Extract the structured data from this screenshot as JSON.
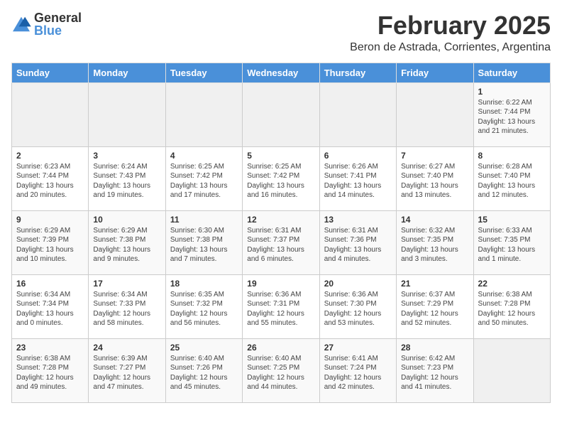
{
  "logo": {
    "general": "General",
    "blue": "Blue"
  },
  "header": {
    "title": "February 2025",
    "subtitle": "Beron de Astrada, Corrientes, Argentina"
  },
  "weekdays": [
    "Sunday",
    "Monday",
    "Tuesday",
    "Wednesday",
    "Thursday",
    "Friday",
    "Saturday"
  ],
  "weeks": [
    [
      {
        "day": "",
        "detail": ""
      },
      {
        "day": "",
        "detail": ""
      },
      {
        "day": "",
        "detail": ""
      },
      {
        "day": "",
        "detail": ""
      },
      {
        "day": "",
        "detail": ""
      },
      {
        "day": "",
        "detail": ""
      },
      {
        "day": "1",
        "detail": "Sunrise: 6:22 AM\nSunset: 7:44 PM\nDaylight: 13 hours\nand 21 minutes."
      }
    ],
    [
      {
        "day": "2",
        "detail": "Sunrise: 6:23 AM\nSunset: 7:44 PM\nDaylight: 13 hours\nand 20 minutes."
      },
      {
        "day": "3",
        "detail": "Sunrise: 6:24 AM\nSunset: 7:43 PM\nDaylight: 13 hours\nand 19 minutes."
      },
      {
        "day": "4",
        "detail": "Sunrise: 6:25 AM\nSunset: 7:42 PM\nDaylight: 13 hours\nand 17 minutes."
      },
      {
        "day": "5",
        "detail": "Sunrise: 6:25 AM\nSunset: 7:42 PM\nDaylight: 13 hours\nand 16 minutes."
      },
      {
        "day": "6",
        "detail": "Sunrise: 6:26 AM\nSunset: 7:41 PM\nDaylight: 13 hours\nand 14 minutes."
      },
      {
        "day": "7",
        "detail": "Sunrise: 6:27 AM\nSunset: 7:40 PM\nDaylight: 13 hours\nand 13 minutes."
      },
      {
        "day": "8",
        "detail": "Sunrise: 6:28 AM\nSunset: 7:40 PM\nDaylight: 13 hours\nand 12 minutes."
      }
    ],
    [
      {
        "day": "9",
        "detail": "Sunrise: 6:29 AM\nSunset: 7:39 PM\nDaylight: 13 hours\nand 10 minutes."
      },
      {
        "day": "10",
        "detail": "Sunrise: 6:29 AM\nSunset: 7:38 PM\nDaylight: 13 hours\nand 9 minutes."
      },
      {
        "day": "11",
        "detail": "Sunrise: 6:30 AM\nSunset: 7:38 PM\nDaylight: 13 hours\nand 7 minutes."
      },
      {
        "day": "12",
        "detail": "Sunrise: 6:31 AM\nSunset: 7:37 PM\nDaylight: 13 hours\nand 6 minutes."
      },
      {
        "day": "13",
        "detail": "Sunrise: 6:31 AM\nSunset: 7:36 PM\nDaylight: 13 hours\nand 4 minutes."
      },
      {
        "day": "14",
        "detail": "Sunrise: 6:32 AM\nSunset: 7:35 PM\nDaylight: 13 hours\nand 3 minutes."
      },
      {
        "day": "15",
        "detail": "Sunrise: 6:33 AM\nSunset: 7:35 PM\nDaylight: 13 hours\nand 1 minute."
      }
    ],
    [
      {
        "day": "16",
        "detail": "Sunrise: 6:34 AM\nSunset: 7:34 PM\nDaylight: 13 hours\nand 0 minutes."
      },
      {
        "day": "17",
        "detail": "Sunrise: 6:34 AM\nSunset: 7:33 PM\nDaylight: 12 hours\nand 58 minutes."
      },
      {
        "day": "18",
        "detail": "Sunrise: 6:35 AM\nSunset: 7:32 PM\nDaylight: 12 hours\nand 56 minutes."
      },
      {
        "day": "19",
        "detail": "Sunrise: 6:36 AM\nSunset: 7:31 PM\nDaylight: 12 hours\nand 55 minutes."
      },
      {
        "day": "20",
        "detail": "Sunrise: 6:36 AM\nSunset: 7:30 PM\nDaylight: 12 hours\nand 53 minutes."
      },
      {
        "day": "21",
        "detail": "Sunrise: 6:37 AM\nSunset: 7:29 PM\nDaylight: 12 hours\nand 52 minutes."
      },
      {
        "day": "22",
        "detail": "Sunrise: 6:38 AM\nSunset: 7:28 PM\nDaylight: 12 hours\nand 50 minutes."
      }
    ],
    [
      {
        "day": "23",
        "detail": "Sunrise: 6:38 AM\nSunset: 7:28 PM\nDaylight: 12 hours\nand 49 minutes."
      },
      {
        "day": "24",
        "detail": "Sunrise: 6:39 AM\nSunset: 7:27 PM\nDaylight: 12 hours\nand 47 minutes."
      },
      {
        "day": "25",
        "detail": "Sunrise: 6:40 AM\nSunset: 7:26 PM\nDaylight: 12 hours\nand 45 minutes."
      },
      {
        "day": "26",
        "detail": "Sunrise: 6:40 AM\nSunset: 7:25 PM\nDaylight: 12 hours\nand 44 minutes."
      },
      {
        "day": "27",
        "detail": "Sunrise: 6:41 AM\nSunset: 7:24 PM\nDaylight: 12 hours\nand 42 minutes."
      },
      {
        "day": "28",
        "detail": "Sunrise: 6:42 AM\nSunset: 7:23 PM\nDaylight: 12 hours\nand 41 minutes."
      },
      {
        "day": "",
        "detail": ""
      }
    ]
  ]
}
